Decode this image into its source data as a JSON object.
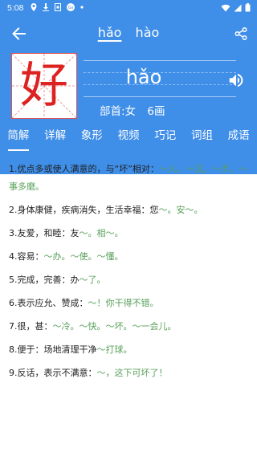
{
  "status": {
    "time": "5:08",
    "icons": [
      "location-icon",
      "download-icon",
      "sim-icon",
      "vpn-icon",
      "dot-icon"
    ],
    "right_icons": [
      "wifi-icon",
      "signal-icon",
      "battery-icon"
    ]
  },
  "header": {
    "pinyin_tabs": [
      "hǎo",
      "hào"
    ],
    "character": "好",
    "pinyin": "hǎo",
    "radical_label": "部首:女",
    "strokes_label": "6画"
  },
  "tabs": [
    "简解",
    "详解",
    "象形",
    "视频",
    "巧记",
    "词组",
    "成语"
  ],
  "definitions": [
    {
      "text": "1.优点多或使人满意的，与“坏”相对：",
      "examples": "～人。～汉。～歹。～事多磨。"
    },
    {
      "text": "2.身体康健，疾病消失，生活幸福：您",
      "examples": "～。安～。"
    },
    {
      "text": "3.友爱，和睦：友",
      "examples": "～。相～。"
    },
    {
      "text": "4.容易：",
      "examples": "～办。～使。～懂。"
    },
    {
      "text": "5.完成，完善：办",
      "examples": "～了。"
    },
    {
      "text": "6.表示应允、赞成：",
      "examples": "～！你干得不错。"
    },
    {
      "text": "7.很，甚：",
      "examples": "～冷。～快。～坏。～一会儿。"
    },
    {
      "text": "8.便于：场地清理干净",
      "examples": "～打球。"
    },
    {
      "text": "9.反话，表示不满意：",
      "examples": "～，这下可坏了！"
    }
  ],
  "colors": {
    "primary": "#3f8ee8",
    "accent_red": "#d22222",
    "example_green": "#58a05a"
  }
}
